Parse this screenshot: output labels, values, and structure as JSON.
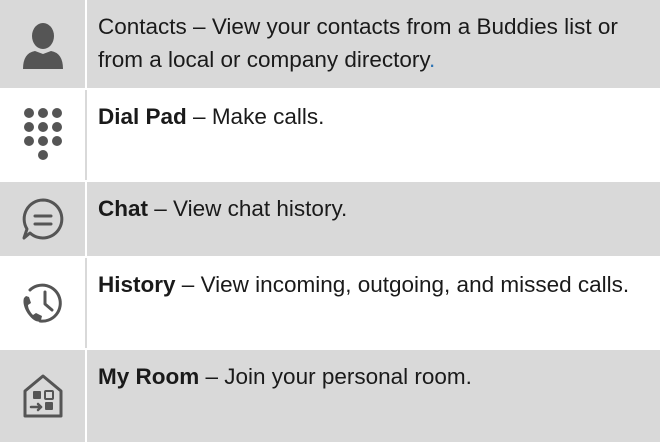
{
  "features": [
    {
      "icon": "contacts-person-icon",
      "name": "Contacts",
      "separator": " – ",
      "description": "View your contacts from a Buddies list or from a local or company directory",
      "trailing": "."
    },
    {
      "icon": "dial-pad-icon",
      "name": "Dial Pad",
      "separator": " – ",
      "description": "Make calls."
    },
    {
      "icon": "chat-bubble-icon",
      "name": "Chat",
      "separator": " – ",
      "description": "View chat history."
    },
    {
      "icon": "history-phone-clock-icon",
      "name": "History",
      "separator": " – ",
      "description": "View incoming, outgoing, and missed calls."
    },
    {
      "icon": "my-room-icon",
      "name": "My Room",
      "separator": " – ",
      "description": "Join your personal room."
    }
  ],
  "colors": {
    "shaded_row": "#d9d9d9",
    "icon_gray": "#555555",
    "text": "#1a1a1a",
    "accent_period": "#2e74b5"
  }
}
